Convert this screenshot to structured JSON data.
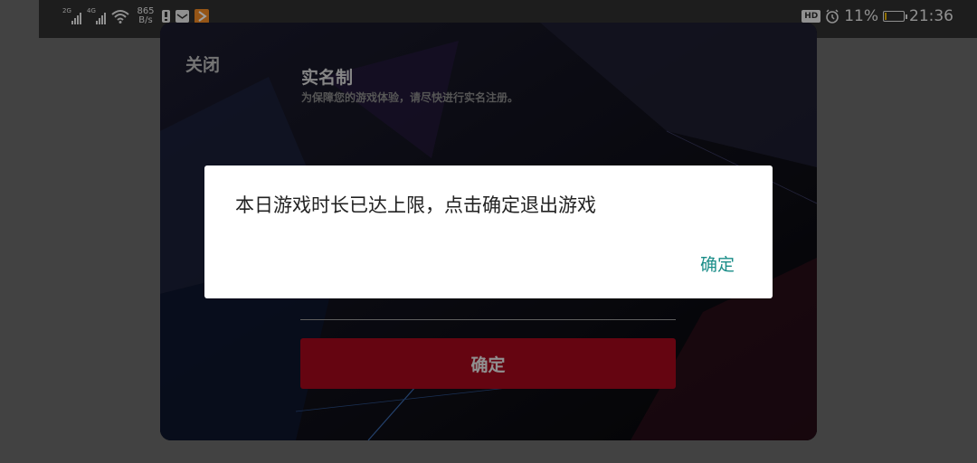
{
  "status_bar": {
    "signal1_tag": "2G",
    "signal2_tag": "4G",
    "net_speed_value": "865",
    "net_speed_unit": "B/s",
    "hd_badge": "HD",
    "battery_percent": "11%",
    "battery_level": 0.11,
    "time": "21:36",
    "icons": [
      "signal-icon",
      "signal-icon",
      "wifi-icon",
      "alert-icon",
      "mail-icon",
      "play-app-icon",
      "alarm-icon",
      "battery-icon"
    ]
  },
  "panel": {
    "close_label": "关闭",
    "title": "实名制",
    "subtitle": "为保障您的游戏体验，请尽快进行实名注册。",
    "confirm_label": "确定"
  },
  "dialog": {
    "message": "本日游戏时长已达上限，点击确定退出游戏",
    "ok_label": "确定"
  },
  "colors": {
    "accent_teal": "#1a8d88",
    "confirm_red": "#a3091c",
    "battery_low": "#e8b400"
  }
}
